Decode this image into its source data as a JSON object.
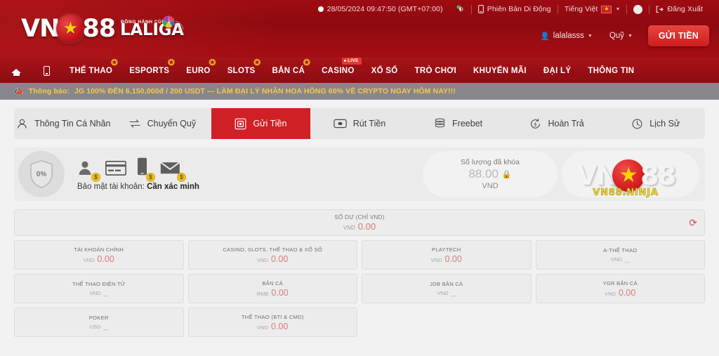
{
  "header": {
    "logo": {
      "vn": "VN",
      "star": "★",
      "num": "88",
      "tagline": "ĐỒNG HÀNH CÙNG",
      "league": "LALIGA"
    },
    "topbar": {
      "clock_icon": "clock-icon",
      "datetime": "28/05/2024 09:47:50 (GMT+07:00)",
      "sound_icon": "sound-icon",
      "mobile_icon": "mobile-icon",
      "mobile_label": "Phiên Bản Di Động",
      "language_label": "Tiếng Việt",
      "language_flag": "vietnam-flag-icon",
      "avatar": "user-avatar",
      "logout_icon": "logout-icon",
      "logout_label": "Đăng Xuất"
    },
    "userbar": {
      "user_icon": "user-icon",
      "username": "lalalasss",
      "wallet_label": "Quỹ",
      "deposit_label": "GỬI TIỀN"
    }
  },
  "nav": {
    "items": [
      {
        "label": "",
        "icon": "home-icon",
        "badge": ""
      },
      {
        "label": "",
        "icon": "mobile-icon",
        "badge": ""
      },
      {
        "label": "THỂ THAO",
        "icon": "",
        "badge": "star"
      },
      {
        "label": "ESPORTS",
        "icon": "",
        "badge": "star"
      },
      {
        "label": "EURO",
        "icon": "",
        "badge": "star"
      },
      {
        "label": "SLOTS",
        "icon": "",
        "badge": "star"
      },
      {
        "label": "BẮN CÁ",
        "icon": "",
        "badge": "star"
      },
      {
        "label": "CASINO",
        "icon": "",
        "badge": "live",
        "badge_text": "LIVE"
      },
      {
        "label": "XỔ SỐ",
        "icon": "",
        "badge": ""
      },
      {
        "label": "TRÒ CHƠI",
        "icon": "",
        "badge": ""
      },
      {
        "label": "KHUYẾN MÃI",
        "icon": "",
        "badge": ""
      },
      {
        "label": "ĐẠI LÝ",
        "icon": "",
        "badge": ""
      },
      {
        "label": "THÔNG TIN",
        "icon": "",
        "badge": ""
      }
    ]
  },
  "announcement": {
    "icon": "megaphone-icon",
    "label": "Thông báo:",
    "text": "JG 100% ĐẾN 6,150,000đ / 200 USDT --- LÀM ĐẠI LÝ NHẬN HOA HỒNG 60% VỀ CRYPTO NGAY HÔM NAY!!!"
  },
  "tabs": [
    {
      "label": "Thông Tin Cá Nhân",
      "icon": "person-icon",
      "active": false
    },
    {
      "label": "Chuyển Quỹ",
      "icon": "transfer-icon",
      "active": false
    },
    {
      "label": "Gửi Tiền",
      "icon": "deposit-icon",
      "active": true
    },
    {
      "label": "Rút Tiền",
      "icon": "banknote-icon",
      "active": false
    },
    {
      "label": "Freebet",
      "icon": "coins-icon",
      "active": false
    },
    {
      "label": "Hoàn Trả",
      "icon": "rebate-icon",
      "active": false
    },
    {
      "label": "Lịch Sử",
      "icon": "history-icon",
      "active": false
    }
  ],
  "security": {
    "percent": "0%",
    "shield_icon": "shield-icon",
    "icons": [
      "profile-verify-icon",
      "card-verify-icon",
      "phone-verify-icon",
      "email-verify-icon"
    ],
    "coin_symbol": "$",
    "label": "Bảo mật tài khoản:",
    "status": "Cần xác minh"
  },
  "locked": {
    "label": "Số lượng đã khóa",
    "amount": "88.00",
    "lock_icon": "lock-icon",
    "currency": "VND"
  },
  "watermark": {
    "vn": "VN",
    "star": "★",
    "num": "88",
    "sub": "VN88.NINJA"
  },
  "balance": {
    "label": "SỐ DƯ (CHỈ VND)",
    "currency": "VND",
    "amount": "0.00",
    "refresh_icon": "refresh-icon"
  },
  "wallets": [
    {
      "name": "TÀI KHOẢN CHÍNH",
      "currency": "VND",
      "amount": "0.00",
      "dash": false
    },
    {
      "name": "CASINO, SLOTS, THỂ THAO & XỔ SỐ",
      "currency": "VND",
      "amount": "0.00",
      "dash": false
    },
    {
      "name": "PLAYTECH",
      "currency": "VND",
      "amount": "0.00",
      "dash": false
    },
    {
      "name": "A-THỂ THAO",
      "currency": "VND",
      "amount": "_",
      "dash": true
    },
    {
      "name": "THỂ THAO ĐIỆN TỬ",
      "currency": "VND",
      "amount": "_",
      "dash": true
    },
    {
      "name": "BẮN CÁ",
      "currency": "RMB",
      "amount": "0.00",
      "dash": false
    },
    {
      "name": "JDB BẮN CÁ",
      "currency": "VND",
      "amount": "_",
      "dash": true
    },
    {
      "name": "YGR BẮN CÁ",
      "currency": "VND",
      "amount": "0.00",
      "dash": false
    },
    {
      "name": "POKER",
      "currency": "USD",
      "amount": "_",
      "dash": true
    },
    {
      "name": "THỂ THAO (BTI & CMD)",
      "currency": "VND",
      "amount": "0.00",
      "dash": false
    }
  ],
  "colors": {
    "brand_red": "#cf2026",
    "header_red": "#981017",
    "accent_gold": "#f4c84a",
    "amount_red": "#d67c7c"
  }
}
